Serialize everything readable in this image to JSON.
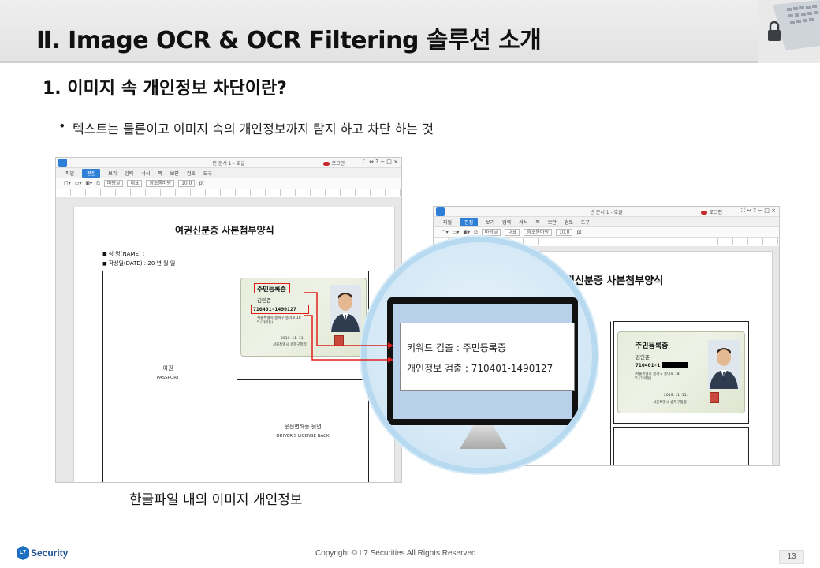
{
  "slide": {
    "title": "Ⅱ. Image OCR & OCR Filtering 솔루션 소개",
    "subtitle": "1. 이미지 속 개인정보 차단이란?",
    "bullet": "텍스트는 물론이고 이미지 속의 개인정보까지 탐지 하고 차단 하는 것",
    "caption": "한글파일 내의 이미지 개인정보",
    "corner_image_icon": "laptop-lock-icon"
  },
  "hwp_window": {
    "doc_title": "빈 문서 1 - 호글",
    "login": "로그인",
    "window_buttons": "⛶ ⇔ ? − □ ×",
    "menu": [
      "파일",
      "편집",
      "보기",
      "입력",
      "서식",
      "쪽",
      "보안",
      "검토",
      "도구"
    ],
    "active_menu": "편집",
    "style_select": "바탕글",
    "outline_select": "대표",
    "font_select": "함초롬바탕",
    "font_size": "10.0",
    "size_unit": "pt"
  },
  "document": {
    "form_title": "여권신분증 사본첨부양식",
    "form_title_partial": "권신분증 사본첨부양식",
    "name_field": "성   명(NAME) :",
    "date_field": "작성일(DATE) : 20  년    월    일",
    "passport_label": "여권",
    "passport_label_en": "PASSPORT",
    "license_label": "운전면허증 뒷면",
    "license_label_en": "DRIVER'S LICENSE BACK"
  },
  "id_card": {
    "title": "주민등록증",
    "name": "김민준",
    "number": "710401-1490127",
    "number_masked": "710401-1",
    "address": "서울특별시 송파구 송이로 18",
    "address2": "5 (가락동)",
    "issue_date": "2019. 11. 11.",
    "issuer": "서울특별시 송파구청장"
  },
  "ocr_result": {
    "keyword_line": "키워드 검출 : 주민등록증",
    "pii_line": "개인정보 검출 : 710401-1490127"
  },
  "footer": {
    "logo_text": "Security",
    "logo_mark": "L7",
    "copyright": "Copyright © L7 Securities All Rights Reserved.",
    "page_number": "13"
  },
  "colors": {
    "accent_blue": "#2e7fd6",
    "highlight_red": "#e0201b",
    "magnifier_ring": "#b7daf1"
  }
}
